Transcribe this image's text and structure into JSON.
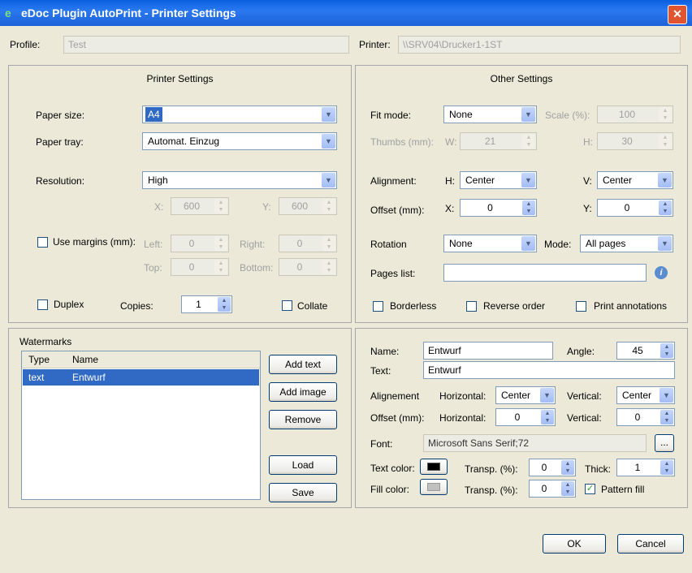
{
  "window": {
    "title": "eDoc Plugin AutoPrint - Printer Settings",
    "close": "✕",
    "app_icon": "e"
  },
  "top": {
    "profile_label": "Profile:",
    "profile_value": "Test",
    "printer_label": "Printer:",
    "printer_value": "\\\\SRV04\\Drucker1-1ST"
  },
  "printer_settings": {
    "header": "Printer Settings",
    "paper_size_label": "Paper size:",
    "paper_size": "A4",
    "paper_tray_label": "Paper tray:",
    "paper_tray": "Automat. Einzug",
    "resolution_label": "Resolution:",
    "resolution": "High",
    "res_x_label": "X:",
    "res_x": "600",
    "res_y_label": "Y:",
    "res_y": "600",
    "use_margins_label": "Use margins (mm):",
    "left_label": "Left:",
    "left": "0",
    "right_label": "Right:",
    "right": "0",
    "top_label": "Top:",
    "top": "0",
    "bottom_label": "Bottom:",
    "bottom": "0",
    "duplex_label": "Duplex",
    "copies_label": "Copies:",
    "copies": "1",
    "collate_label": "Collate"
  },
  "other_settings": {
    "header": "Other Settings",
    "fit_mode_label": "Fit mode:",
    "fit_mode": "None",
    "scale_label": "Scale (%):",
    "scale": "100",
    "thumbs_label": "Thumbs (mm):",
    "thumbs_w_label": "W:",
    "thumbs_w": "21",
    "thumbs_h_label": "H:",
    "thumbs_h": "30",
    "alignment_label": "Alignment:",
    "align_h_label": "H:",
    "align_h": "Center",
    "align_v_label": "V:",
    "align_v": "Center",
    "offset_label": "Offset (mm):",
    "offset_x_label": "X:",
    "offset_x": "0",
    "offset_y_label": "Y:",
    "offset_y": "0",
    "rotation_label": "Rotation",
    "rotation": "None",
    "mode_label": "Mode:",
    "mode": "All pages",
    "pages_list_label": "Pages list:",
    "pages_list": "",
    "borderless_label": "Borderless",
    "reverse_order_label": "Reverse order",
    "print_annotations_label": "Print annotations"
  },
  "watermarks": {
    "header": "Watermarks",
    "columns": [
      "Type",
      "Name"
    ],
    "rows": [
      {
        "type": "text",
        "name": "Entwurf"
      }
    ],
    "add_text": "Add text",
    "add_image": "Add image",
    "remove": "Remove",
    "load": "Load",
    "save": "Save"
  },
  "watermark_detail": {
    "name_label": "Name:",
    "name": "Entwurf",
    "angle_label": "Angle:",
    "angle": "45",
    "text_label": "Text:",
    "text": "Entwurf",
    "alignment_label": "Alignement",
    "horizontal_label": "Horizontal:",
    "horizontal": "Center",
    "vertical_label": "Vertical:",
    "vertical": "Center",
    "offset_label": "Offset (mm):",
    "off_horizontal_label": "Horizontal:",
    "off_horizontal": "0",
    "off_vertical_label": "Vertical:",
    "off_vertical": "0",
    "font_label": "Font:",
    "font": "Microsoft Sans Serif;72",
    "font_button": "...",
    "text_color_label": "Text color:",
    "text_color": "#000000",
    "fill_color_label": "Fill color:",
    "fill_color": "#c0c0c0",
    "transp_label": "Transp. (%):",
    "text_transp": "0",
    "fill_transp": "0",
    "thick_label": "Thick:",
    "thick": "1",
    "pattern_fill_label": "Pattern fill"
  },
  "footer": {
    "ok": "OK",
    "cancel": "Cancel"
  }
}
